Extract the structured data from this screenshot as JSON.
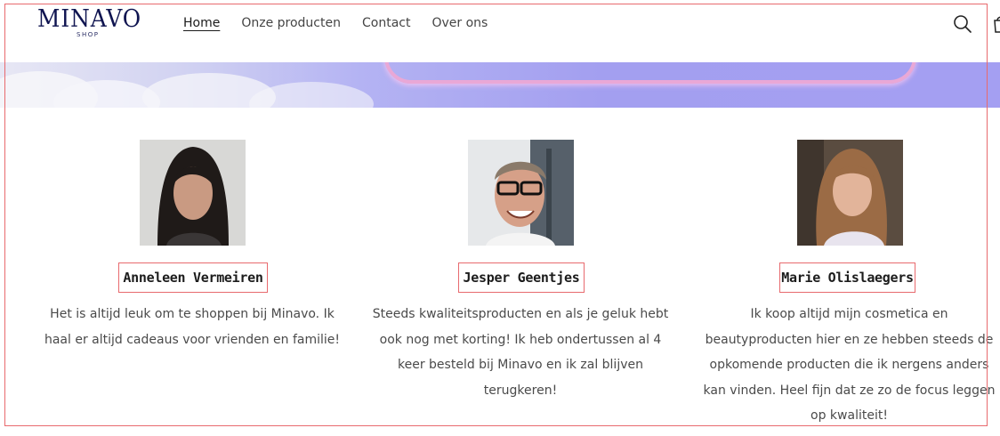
{
  "header": {
    "logo_main": "MINAVO",
    "logo_sub": "SHOP",
    "nav": [
      {
        "label": "Home",
        "active": true
      },
      {
        "label": "Onze producten",
        "active": false
      },
      {
        "label": "Contact",
        "active": false
      },
      {
        "label": "Over ons",
        "active": false
      }
    ],
    "icons": [
      "search-icon",
      "cart-icon"
    ]
  },
  "reviews": [
    {
      "name": "Anneleen Vermeiren",
      "quote": "Het is altijd leuk om te shoppen bij Minavo. Ik haal er altijd cadeaus voor vrienden en familie!"
    },
    {
      "name": "Jesper Geentjes",
      "quote": "Steeds kwaliteitsproducten en als je geluk hebt ook nog met korting! Ik heb ondertussen al 4 keer besteld bij Minavo en ik zal blijven terugkeren!"
    },
    {
      "name": "Marie Olislaegers",
      "quote": "Ik koop altijd mijn cosmetica en beautyproducten hier en ze hebben steeds de opkomende producten die ik nergens anders kan vinden. Heel fijn dat ze zo de focus leggen op kwaliteit!"
    }
  ],
  "colors": {
    "logo": "#0f1450",
    "highlight_border": "#e86a6e",
    "banner": "#a39ff0"
  }
}
